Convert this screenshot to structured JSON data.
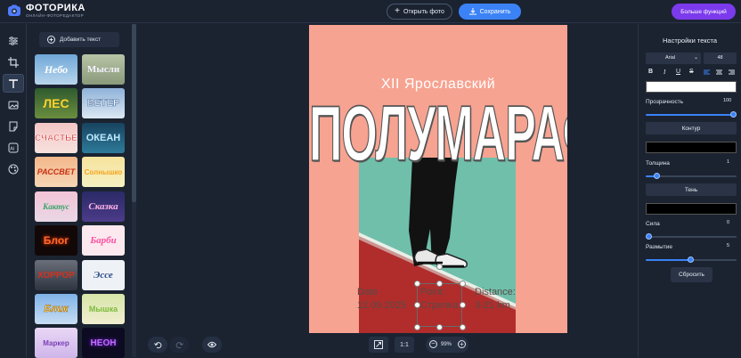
{
  "app": {
    "title": "ФОТОРИКА",
    "subtitle": "ОНЛАЙН-ФОТОРЕДАКТОР"
  },
  "header": {
    "open_label": "Открыть фото",
    "save_label": "Сохранить",
    "more_label": "Больше функций"
  },
  "sidebar": {
    "add_text_label": "Добавить текст",
    "presets": [
      "Небо",
      "Мысли",
      "ЛЕС",
      "ВЕТЕР",
      "СЧАСТЬЕ",
      "ОКЕАН",
      "РАССВЕТ",
      "Солнышко",
      "Кактус",
      "Сказка",
      "Блог",
      "Барби",
      "ХОРРОР",
      "Эссе",
      "Блик",
      "Мышка",
      "Маркер",
      "НЕОН"
    ]
  },
  "poster": {
    "line1": "XII Ярославский",
    "line2": "ПОЛУМАРАФОН",
    "date_label": "Date",
    "date_value": "12.09.2025",
    "point_label": "Point:",
    "point_value": "Стрелка",
    "distance_label": "Distance:",
    "distance_value": "3-21 km"
  },
  "settings": {
    "title": "Настройки текста",
    "font": "Arial",
    "size": "48",
    "opacity_label": "Прозрачность",
    "opacity_value": "100",
    "opacity_level": 1.0,
    "outline_label": "Контур",
    "thickness_label": "Толщина",
    "thickness_value": "1",
    "thickness_level": 0.12,
    "shadow_label": "Тень",
    "strength_label": "Сила",
    "strength_value": "0",
    "strength_level": 0.0,
    "blur_label": "Размытие",
    "blur_value": "5",
    "blur_level": 0.5,
    "reset_label": "Сбросить",
    "text_color": "#ffffff",
    "outline_color": "#000000",
    "shadow_color": "#000000"
  },
  "bottom": {
    "zoom": "99%",
    "ratio": "1:1"
  },
  "colors": {
    "accent": "#3b82f6",
    "brand": "#7c3aed",
    "poster_bg": "#f7a391"
  }
}
